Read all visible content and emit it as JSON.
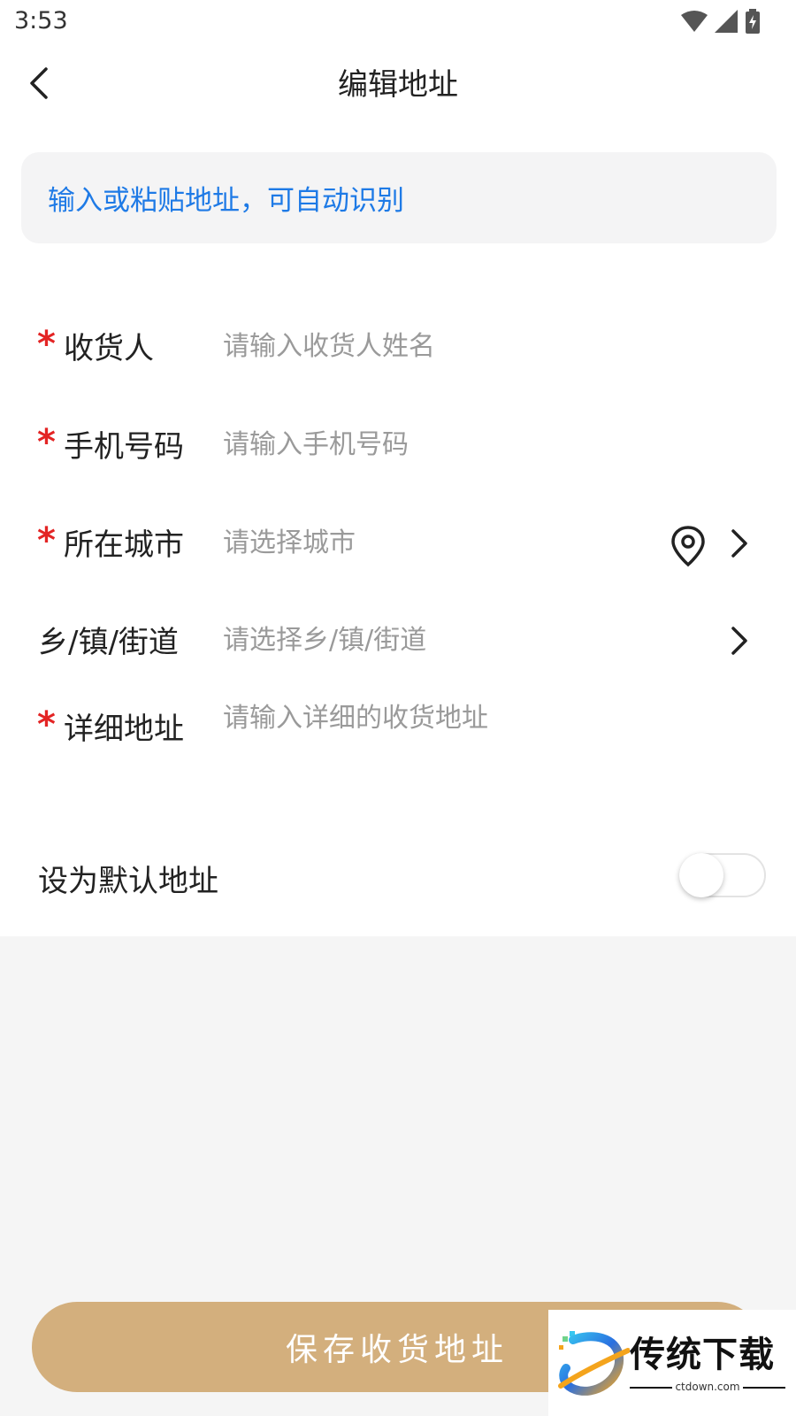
{
  "status_bar": {
    "time": "3:53",
    "icons": [
      "wifi-icon",
      "signal-icon",
      "battery-charging-icon"
    ]
  },
  "header": {
    "back_icon": "chevron-left-icon",
    "title": "编辑地址"
  },
  "paste_box": {
    "text": "输入或粘贴地址，可自动识别",
    "color": "#1e7ae6"
  },
  "form": {
    "required_mark": "*",
    "rows": [
      {
        "label": "收货人",
        "placeholder": "请输入收货人姓名",
        "required": true
      },
      {
        "label": "手机号码",
        "placeholder": "请输入手机号码",
        "required": true
      },
      {
        "label": "所在城市",
        "placeholder": "请选择城市",
        "required": true,
        "icons": [
          "location-pin-icon",
          "chevron-right-icon"
        ]
      },
      {
        "label": "乡/镇/街道",
        "placeholder": "请选择乡/镇/街道",
        "required": false,
        "icons": [
          "chevron-right-icon"
        ]
      },
      {
        "label": "详细地址",
        "placeholder": "请输入详细的收货地址",
        "required": true
      }
    ]
  },
  "default_address": {
    "label": "设为默认地址",
    "toggle_on": false
  },
  "save_button": {
    "label": "保存收货地址",
    "color": "#d3af7d"
  },
  "watermark": {
    "title": "传统下载",
    "subtitle": "ctdown.com"
  }
}
